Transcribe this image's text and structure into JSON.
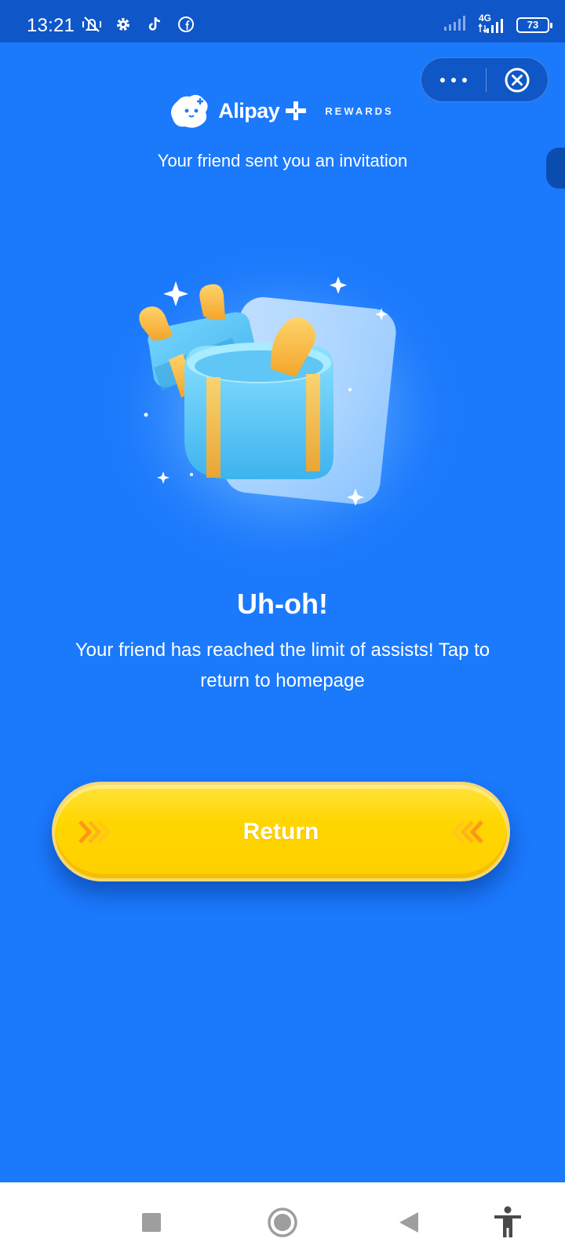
{
  "status_bar": {
    "time": "13:21",
    "network": "4G",
    "battery": "73",
    "icons": [
      "vibrate-off-icon",
      "settings-gear-icon",
      "tiktok-icon",
      "facebook-icon",
      "signal-icon",
      "battery-icon"
    ]
  },
  "capsule": {
    "more_icon": "more-dots-icon",
    "close_icon": "close-circle-icon"
  },
  "logo": {
    "name": "Alipay",
    "plus_icon": "plus-icon",
    "tagline": "REWARDS"
  },
  "invite_text": "Your friend sent you an invitation",
  "illustration": "open-gift-box",
  "headline": "Uh-oh!",
  "message": "Your friend has reached the limit of assists! Tap to return to homepage",
  "return_button": {
    "label": "Return"
  },
  "nav": [
    "recents-square-icon",
    "home-circle-icon",
    "back-triangle-icon",
    "accessibility-icon"
  ],
  "colors": {
    "background": "#1B79FC",
    "status_bar": "#0F56C8",
    "button": "#FFD600",
    "chevron": "#FF9A1F",
    "gift": "#5FC6F5",
    "ribbon": "#F7B53A"
  }
}
